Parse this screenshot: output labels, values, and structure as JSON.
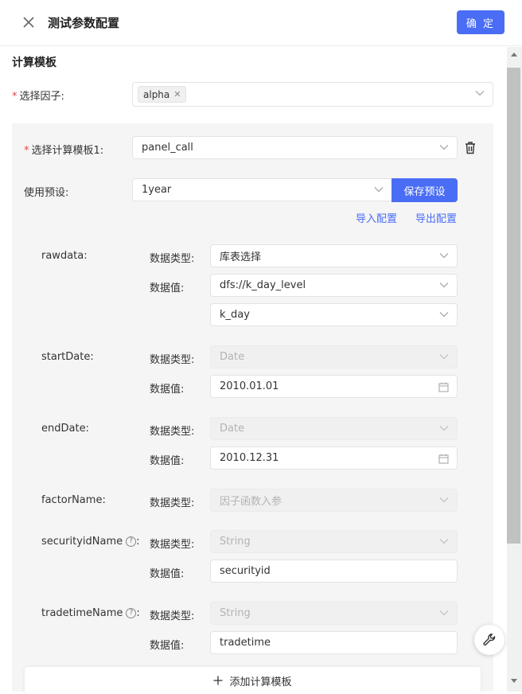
{
  "header": {
    "title": "测试参数配置",
    "confirm_label": "确 定"
  },
  "section_title": "计算模板",
  "factor": {
    "label": "选择因子:",
    "tags": [
      "alpha"
    ]
  },
  "template": {
    "label": "选择计算模板1:",
    "value": "panel_call",
    "preset_label": "使用预设:",
    "preset_value": "1year",
    "save_preset_label": "保存预设",
    "import_label": "导入配置",
    "export_label": "导出配置"
  },
  "params": {
    "type_label": "数据类型:",
    "value_label": "数据值:",
    "rawdata": {
      "name": "rawdata:",
      "type": "库表选择",
      "value1": "dfs://k_day_level",
      "value2": "k_day"
    },
    "startDate": {
      "name": "startDate:",
      "type": "Date",
      "value": "2010.01.01"
    },
    "endDate": {
      "name": "endDate:",
      "type": "Date",
      "value": "2010.12.31"
    },
    "factorName": {
      "name": "factorName:",
      "type": "因子函数入参"
    },
    "securityidName": {
      "name": "securityidName",
      "colon": ":",
      "type": "String",
      "value": "securityid"
    },
    "tradetimeName": {
      "name": "tradetimeName",
      "colon": ":",
      "type": "String",
      "value": "tradetime"
    }
  },
  "add_template_label": "添加计算模板",
  "colors": {
    "primary": "#4a6df5",
    "required": "#e54545",
    "panel_bg": "#f5f5f5"
  }
}
